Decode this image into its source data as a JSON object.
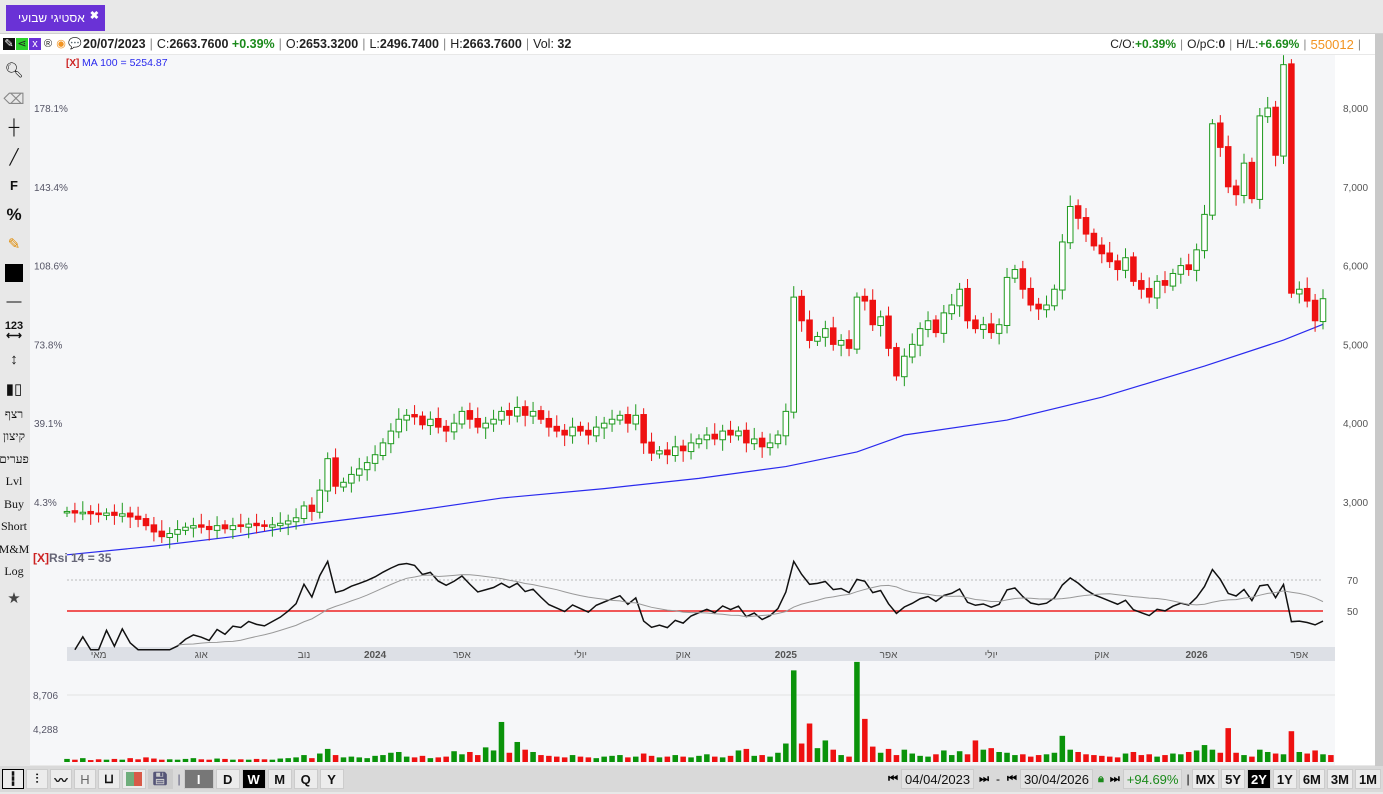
{
  "tab": {
    "title": "אסטיגי שבועי",
    "close": "✖"
  },
  "info": {
    "date": "20/07/2023",
    "c_label": "C:",
    "close": "2663.7600",
    "change": "+0.39%",
    "o_label": "O:",
    "open": "2653.3200",
    "l_label": "L:",
    "low": "2496.7400",
    "h_label": "H:",
    "high": "2663.7600",
    "vol_label": "Vol:",
    "vol": "32",
    "co_label": "C/O:",
    "co": "+0.39%",
    "opc_label": "O/pC:",
    "opc": "0",
    "hl_label": "H/L:",
    "hl": "+6.69%",
    "code": "550012"
  },
  "tools": [
    "search",
    "eraser",
    "crosshair",
    "line",
    "F",
    "%",
    "edit",
    "color",
    "hline",
    "123",
    "vertical",
    "candles"
  ],
  "text_tools": [
    "רצף",
    "קיצון",
    "פערים",
    "Lvl",
    "Buy",
    "Short",
    "M&M",
    "Log"
  ],
  "bottom": {
    "chart_types": [
      "candles",
      "bars",
      "line",
      "H",
      "U",
      "colors",
      "save"
    ],
    "periods": [
      "I",
      "D",
      "W",
      "M",
      "Q",
      "Y"
    ],
    "selected_period": "W",
    "start_date": "04/04/2023",
    "end_date": "30/04/2026",
    "range_change": "+94.69%",
    "ranges": [
      "MX",
      "5Y",
      "2Y",
      "1Y",
      "6M",
      "3M",
      "1M"
    ],
    "selected_range": "2Y"
  },
  "chart_data": {
    "type": "candlestick",
    "ma_label": "[X]",
    "ma_text": "MA 100 = 5254.87",
    "rsi_label": "[X]",
    "rsi_text": "Rsi 14 = 35",
    "price_ticks": [
      "8,000",
      "7,000",
      "6,000",
      "5,000",
      "4,000",
      "3,000"
    ],
    "price_tick_values": [
      8000,
      7000,
      6000,
      5000,
      4000,
      3000
    ],
    "pct_ticks": [
      "178.1%",
      "143.4%",
      "108.6%",
      "73.8%",
      "39.1%",
      "4.3%"
    ],
    "rsi_ticks": [
      "70",
      "50"
    ],
    "volume_ticks": [
      "8,706",
      "4,288"
    ],
    "volume_tick_values": [
      8706,
      4288
    ],
    "x_labels": [
      "מאי",
      "אוג",
      "נוב",
      "2024",
      "אפר",
      "יולי",
      "אוק",
      "2025",
      "אפר",
      "יולי",
      "אוק",
      "2026",
      "אפר"
    ],
    "x_label_weeks": [
      4,
      17,
      30,
      39,
      50,
      65,
      78,
      91,
      104,
      117,
      131,
      143,
      156
    ],
    "closes": [
      2880,
      2860,
      2870,
      2850,
      2840,
      2860,
      2830,
      2850,
      2810,
      2780,
      2700,
      2620,
      2560,
      2600,
      2650,
      2680,
      2700,
      2680,
      2650,
      2700,
      2660,
      2700,
      2690,
      2720,
      2700,
      2690,
      2710,
      2730,
      2760,
      2800,
      2950,
      2880,
      3150,
      3550,
      3200,
      3250,
      3350,
      3420,
      3500,
      3600,
      3750,
      3900,
      4050,
      4100,
      4080,
      3980,
      4050,
      3950,
      3900,
      4000,
      4150,
      4050,
      3950,
      4000,
      4050,
      4150,
      4100,
      4200,
      4100,
      4150,
      4050,
      3950,
      3900,
      3850,
      3950,
      3900,
      3850,
      3950,
      4000,
      4050,
      4100,
      4000,
      4100,
      3750,
      3620,
      3650,
      3600,
      3700,
      3650,
      3750,
      3800,
      3850,
      3800,
      3900,
      3850,
      3900,
      3750,
      3800,
      3700,
      3750,
      3850,
      4150,
      5600,
      5300,
      5050,
      5100,
      5200,
      5000,
      5050,
      4950,
      5600,
      5550,
      5250,
      5350,
      4950,
      4600,
      4850,
      5000,
      5200,
      5300,
      5150,
      5400,
      5500,
      5700,
      5300,
      5200,
      5250,
      5150,
      5250,
      5850,
      5950,
      5700,
      5500,
      5450,
      5500,
      5700,
      6300,
      6750,
      6600,
      6400,
      6250,
      6150,
      6050,
      5950,
      6100,
      5800,
      5700,
      5600,
      5800,
      5750,
      5900,
      6000,
      5950,
      6200,
      6650,
      7800,
      7500,
      7000,
      6900,
      7300,
      6850,
      7900,
      8000,
      7400,
      8550,
      5650,
      5700,
      5550,
      5300,
      5580
    ],
    "volumes": [
      400,
      300,
      500,
      250,
      350,
      300,
      400,
      300,
      500,
      350,
      600,
      450,
      300,
      350,
      300,
      400,
      500,
      350,
      300,
      450,
      400,
      300,
      350,
      300,
      400,
      350,
      300,
      450,
      500,
      600,
      900,
      500,
      1100,
      1700,
      900,
      600,
      700,
      600,
      500,
      800,
      900,
      1200,
      1300,
      700,
      600,
      800,
      500,
      600,
      700,
      1400,
      1000,
      1300,
      900,
      1900,
      1500,
      5200,
      1200,
      2600,
      1600,
      1300,
      900,
      800,
      700,
      600,
      900,
      700,
      600,
      500,
      700,
      800,
      900,
      600,
      700,
      1100,
      800,
      600,
      700,
      900,
      700,
      600,
      800,
      1000,
      700,
      600,
      800,
      1500,
      1700,
      800,
      900,
      700,
      1200,
      2400,
      11900,
      2400,
      5000,
      1800,
      2800,
      1600,
      900,
      700,
      13000,
      5600,
      2000,
      1200,
      1700,
      900,
      1600,
      1100,
      800,
      700,
      1000,
      1500,
      900,
      1400,
      1000,
      2800,
      1600,
      1800,
      1300,
      1200,
      900,
      1000,
      700,
      900,
      1000,
      1200,
      3400,
      1600,
      1300,
      1000,
      900,
      800,
      700,
      600,
      1100,
      1300,
      900,
      1000,
      700,
      900,
      1100,
      1000,
      1300,
      1500,
      2200,
      1600,
      1200,
      4400,
      1200,
      900,
      700,
      1600,
      1300,
      1100,
      1000,
      4000,
      1300,
      1100,
      1500,
      1000,
      900
    ],
    "ma_weeks": [
      0,
      11,
      21,
      30,
      42,
      55,
      68,
      80,
      91,
      100,
      106,
      119,
      131,
      144,
      154,
      159
    ],
    "ma_values": [
      2330,
      2440,
      2560,
      2710,
      2860,
      3050,
      3170,
      3300,
      3450,
      3635,
      3850,
      4040,
      4330,
      4725,
      5055,
      5255
    ],
    "rsi_levels": [
      70,
      50
    ],
    "colors": {
      "up": "#1e9a1e",
      "down": "#ee1111",
      "ma": "#2a2aee",
      "rsi": "#111111",
      "rsi_ma": "#999999",
      "level50": "#ee2222"
    }
  }
}
